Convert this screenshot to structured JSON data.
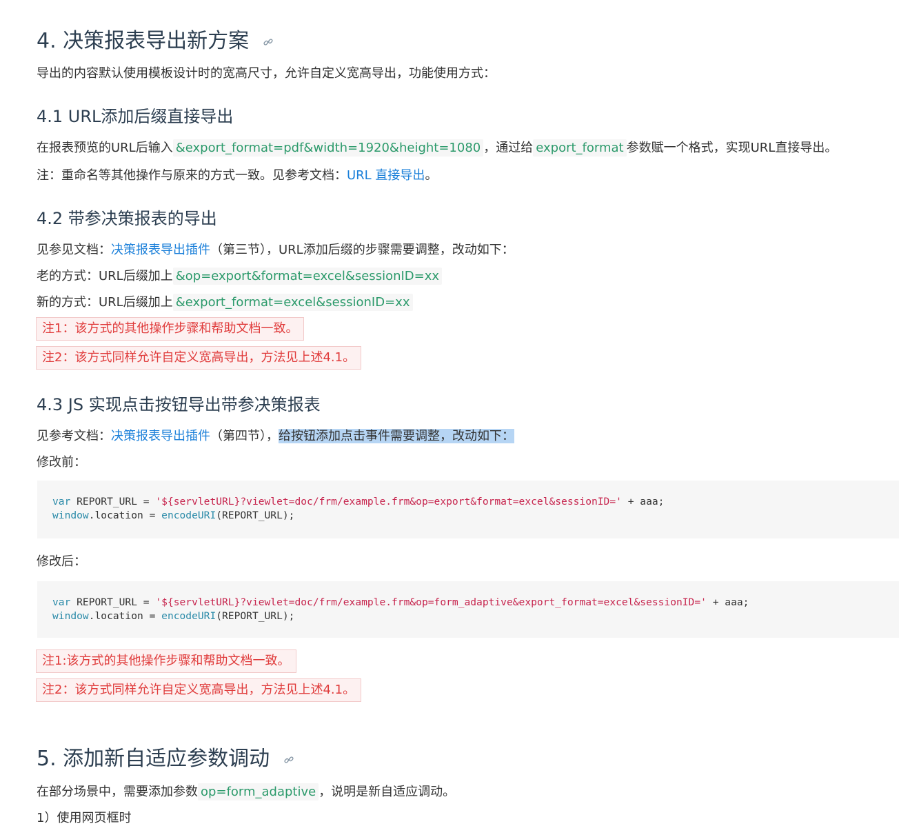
{
  "section4": {
    "heading": "4. 决策报表导出新方案",
    "intro": "导出的内容默认使用模板设计时的宽高尺寸，允许自定义宽高导出，功能使用方式：",
    "s41": {
      "heading": "4.1 URL添加后缀直接导出",
      "p1_a": "在报表预览的URL后输入",
      "p1_code1": "&export_format=pdf&width=1920&height=1080",
      "p1_b": "，通过给",
      "p1_code2": "export_format",
      "p1_c": "参数赋一个格式，实现URL直接导出。",
      "p2_a": "注：重命名等其他操作与原来的方式一致。见参考文档：",
      "p2_link": "URL 直接导出",
      "p2_b": "。"
    },
    "s42": {
      "heading": "4.2 带参决策报表的导出",
      "p1_a": "见参见文档：",
      "p1_link": "决策报表导出插件",
      "p1_b": "（第三节），URL添加后缀的步骤需要调整，改动如下：",
      "old_label": "老的方式：URL后缀加上",
      "old_code": "&op=export&format=excel&sessionID=xx",
      "new_label": "新的方式：URL后缀加上",
      "new_code": "&export_format=excel&sessionID=xx",
      "note1": "注1：该方式的其他操作步骤和帮助文档一致。",
      "note2": "注2：该方式同样允许自定义宽高导出，方法见上述4.1。"
    },
    "s43": {
      "heading": "4.3 JS 实现点击按钮导出带参决策报表",
      "p1_a": "见参考文档：",
      "p1_link": "决策报表导出插件",
      "p1_b": "（第四节），",
      "p1_selected": "给按钮添加点击事件需要调整，改动如下：",
      "before_label": "修改前：",
      "before_code": {
        "kw1": "var",
        "line1_mid": " REPORT_URL = ",
        "line1_str": "'${servletURL}?viewlet=doc/frm/example.frm&op=export&format=excel&sessionID='",
        "line1_end": " + aaa;",
        "kw2": "window",
        "line2_mid": ".location = ",
        "fn": "encodeURI",
        "line2_end": "(REPORT_URL);"
      },
      "after_label": "修改后：",
      "after_code": {
        "kw1": "var",
        "line1_mid": " REPORT_URL = ",
        "line1_str": "'${servletURL}?viewlet=doc/frm/example.frm&op=form_adaptive&export_format=excel&sessionID='",
        "line1_end": " + aaa;",
        "kw2": "window",
        "line2_mid": ".location = ",
        "fn": "encodeURI",
        "line2_end": "(REPORT_URL);"
      },
      "note1": "注1:该方式的其他操作步骤和帮助文档一致。",
      "note2": "注2：该方式同样允许自定义宽高导出，方法见上述4.1。"
    }
  },
  "section5": {
    "heading": "5. 添加新自适应参数调动",
    "p1_a": "在部分场景中，需要添加参数",
    "p1_code": "op=form_adaptive",
    "p1_b": "，说明是新自适应调动。",
    "p2": "1）使用网页框时"
  },
  "colors": {
    "heading": "#2c3e50",
    "link": "#1a7fd9",
    "inline_code": "#2c9a6b",
    "note_text": "#e03c3c",
    "note_bg": "#fdf1f1",
    "code_string": "#c7254e",
    "code_keyword": "#2a8aa8",
    "selection": "#b6d5f4"
  },
  "icons": {
    "anchor": "link-chain-icon"
  }
}
